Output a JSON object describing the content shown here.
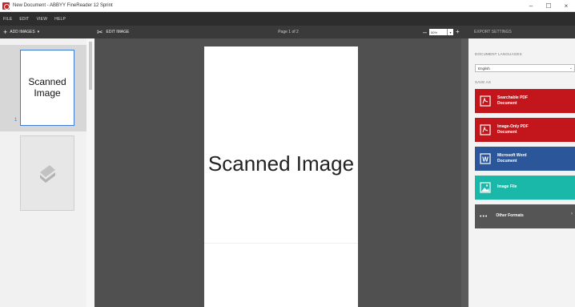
{
  "window": {
    "title": "New Document - ABBYY FineReader 12 Sprint",
    "minimize": "–",
    "maximize": "☐",
    "close": "×"
  },
  "menu": [
    "FILE",
    "EDIT",
    "VIEW",
    "HELP"
  ],
  "toolbar": {
    "add_pages": "ADD IMAGES",
    "add_pages_arrow": "▾",
    "edit_image": "EDIT IMAGE",
    "page_indicator": "Page 1 of 2",
    "zoom_value": "50%",
    "zoom_minus": "–",
    "zoom_plus": "+",
    "zoom_dropdown": "▾",
    "export_settings": "EXPORT SETTINGS"
  },
  "left_panel": {
    "thumbnails": [
      {
        "label": "Scanned Image",
        "page_number": "1",
        "selected": true
      },
      {
        "label": "",
        "icon": "scanner-icon",
        "selected": false
      }
    ]
  },
  "document": {
    "page_text": "Scanned Image"
  },
  "right_panel": {
    "document_languages_label": "DOCUMENT LANGUAGES",
    "language_value": "English",
    "save_as_label": "SAVE AS",
    "export_buttons": [
      {
        "label": "Searchable PDF\nDocument",
        "icon": "pdf-icon",
        "color": "#c3161c"
      },
      {
        "label": "Image-Only PDF\nDocument",
        "icon": "pdf-icon",
        "color": "#c3161c"
      },
      {
        "label": "Microsoft Word\nDocument",
        "icon": "word-icon",
        "color": "#2b579a"
      },
      {
        "label": "Image File",
        "icon": "image-icon",
        "color": "#19b8a8"
      },
      {
        "label": "Other Formats",
        "icon": "more-icon",
        "color": "#555555"
      }
    ]
  }
}
